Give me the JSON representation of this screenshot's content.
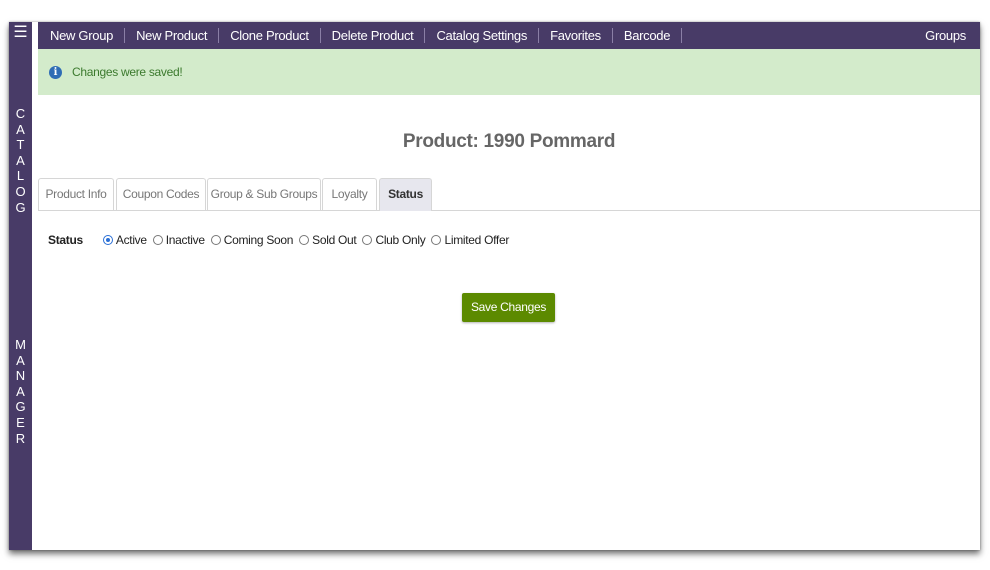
{
  "sidebar": {
    "menu_icon": "hamburger-icon",
    "catalog_letters": [
      "C",
      "A",
      "T",
      "A",
      "L",
      "O",
      "G"
    ],
    "manager_letters": [
      "M",
      "A",
      "N",
      "A",
      "G",
      "E",
      "R"
    ]
  },
  "nav": {
    "items": [
      {
        "label": "New Group"
      },
      {
        "label": "New Product"
      },
      {
        "label": "Clone Product"
      },
      {
        "label": "Delete Product"
      },
      {
        "label": "Catalog Settings"
      },
      {
        "label": "Favorites"
      },
      {
        "label": "Barcode"
      }
    ],
    "right_label": "Groups"
  },
  "alert": {
    "icon": "info-icon",
    "message": "Changes were saved!"
  },
  "page": {
    "title": "Product: 1990 Pommard"
  },
  "tabs": [
    {
      "label": "Product Info",
      "active": false
    },
    {
      "label": "Coupon Codes",
      "active": false
    },
    {
      "label": "Group & Sub Groups",
      "active": false
    },
    {
      "label": "Loyalty",
      "active": false
    },
    {
      "label": "Status",
      "active": true
    }
  ],
  "status": {
    "label": "Status",
    "options": [
      {
        "label": "Active",
        "checked": true
      },
      {
        "label": "Inactive",
        "checked": false
      },
      {
        "label": "Coming Soon",
        "checked": false
      },
      {
        "label": "Sold Out",
        "checked": false
      },
      {
        "label": "Club Only",
        "checked": false
      },
      {
        "label": "Limited Offer",
        "checked": false
      }
    ]
  },
  "actions": {
    "save_label": "Save Changes"
  },
  "colors": {
    "brand_purple": "#483b67",
    "success_bg": "#d3ebcb",
    "success_text": "#3c7a2e",
    "button_green": "#5c8a00"
  }
}
